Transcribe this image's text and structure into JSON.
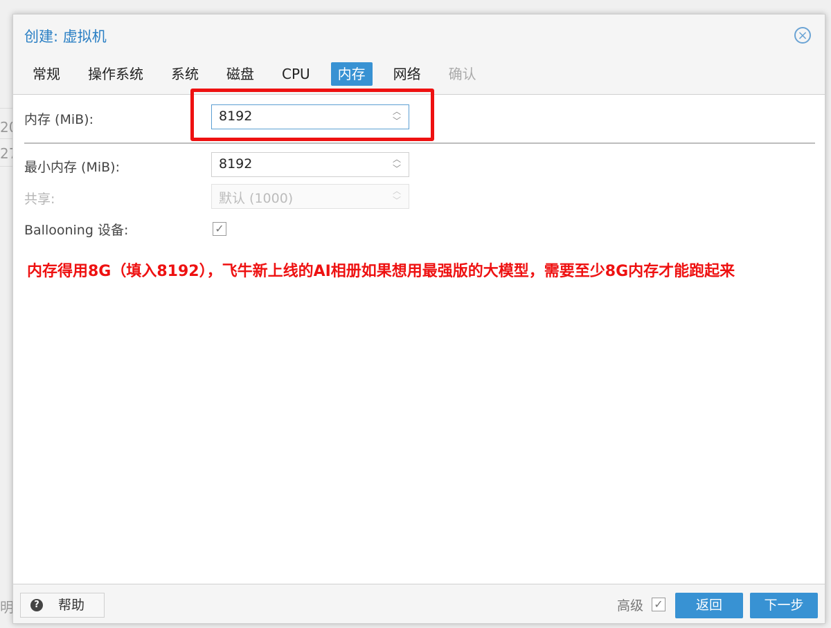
{
  "background": {
    "frag_1": "20",
    "frag_2": "27",
    "frag_3": "明"
  },
  "dialog": {
    "title": "创建: 虚拟机",
    "close_icon": "close-icon",
    "tabs": [
      {
        "label": "常规",
        "state": "normal"
      },
      {
        "label": "操作系统",
        "state": "normal"
      },
      {
        "label": "系统",
        "state": "normal"
      },
      {
        "label": "磁盘",
        "state": "normal"
      },
      {
        "label": "CPU",
        "state": "normal"
      },
      {
        "label": "内存",
        "state": "active"
      },
      {
        "label": "网络",
        "state": "normal"
      },
      {
        "label": "确认",
        "state": "disabled"
      }
    ]
  },
  "form": {
    "memory": {
      "label": "内存 (MiB):",
      "value": "8192"
    },
    "min_memory": {
      "label": "最小内存 (MiB):",
      "value": "8192"
    },
    "shares": {
      "label": "共享:",
      "value": "默认 (1000)"
    },
    "ballooning": {
      "label": "Ballooning 设备:",
      "checked": true
    }
  },
  "annotation": "内存得用8G（填入8192），飞牛新上线的AI相册如果想用最强版的大模型，需要至少8G内存才能跑起来",
  "footer": {
    "help_label": "帮助",
    "advanced_label": "高级",
    "advanced_checked": true,
    "back_label": "返回",
    "next_label": "下一步"
  },
  "colors": {
    "accent": "#3892d3",
    "title": "#2a7fc4",
    "annotation": "#ee1111"
  }
}
